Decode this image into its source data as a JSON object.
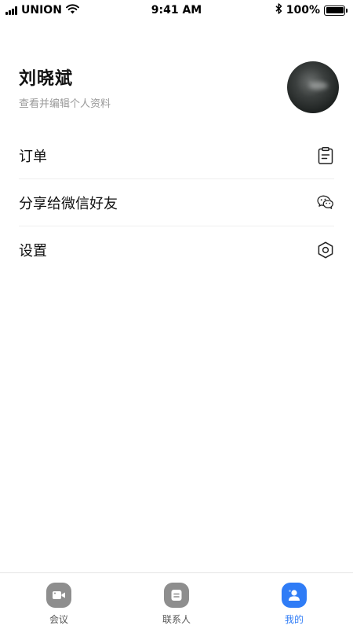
{
  "status_bar": {
    "carrier": "UNION",
    "time": "9:41 AM",
    "battery": "100%",
    "icons": [
      "signal-icon",
      "wifi-icon",
      "bluetooth-icon",
      "battery-icon"
    ]
  },
  "profile": {
    "name": "刘晓斌",
    "subtitle": "查看并编辑个人资料"
  },
  "menu": {
    "items": [
      {
        "label": "订单",
        "icon": "clipboard-icon"
      },
      {
        "label": "分享给微信好友",
        "icon": "wechat-icon"
      },
      {
        "label": "设置",
        "icon": "settings-hexagon-icon"
      }
    ]
  },
  "tab_bar": {
    "active": "mine",
    "tabs": [
      {
        "label": "会议",
        "icon": "video-camera-icon"
      },
      {
        "label": "联系人",
        "icon": "contacts-icon"
      },
      {
        "label": "我的",
        "icon": "profile-icon"
      }
    ]
  },
  "colors": {
    "accent": "#2f7cf6",
    "inactive_tab_icon": "#8e8e8e",
    "subtitle_text": "#999999"
  }
}
